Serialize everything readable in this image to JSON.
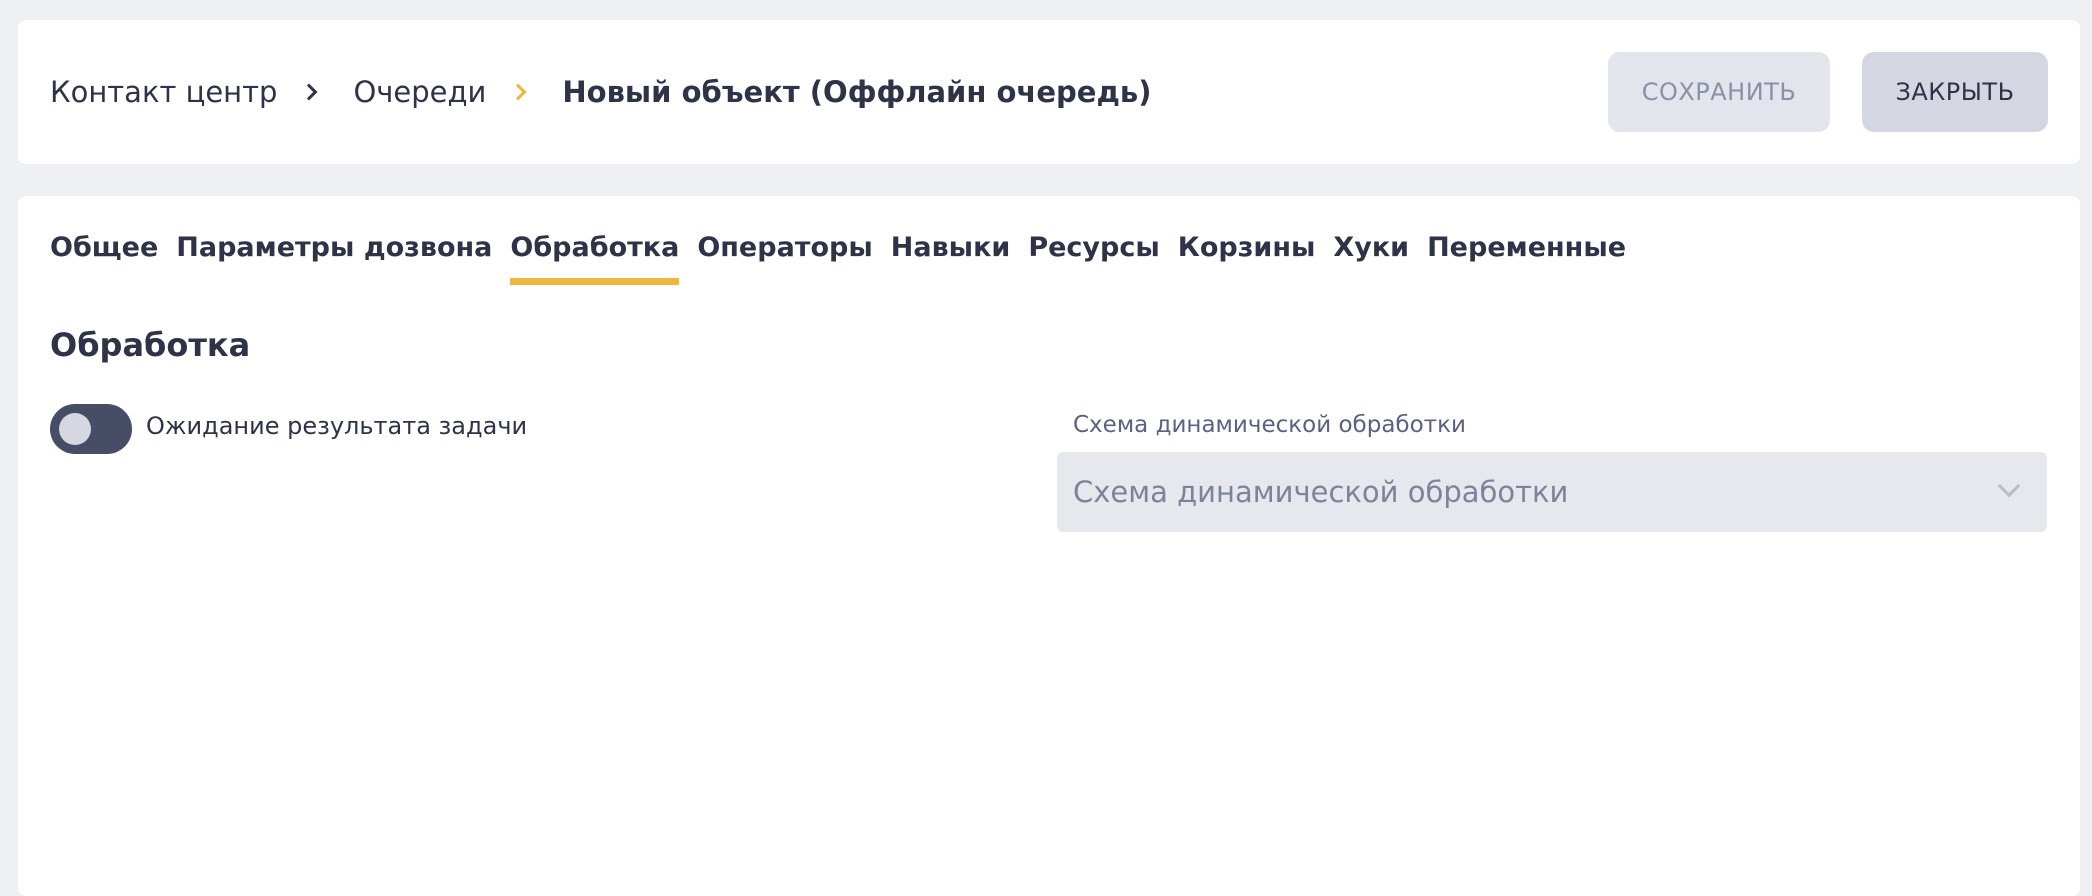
{
  "breadcrumb": {
    "items": [
      "Контакт центр",
      "Очереди"
    ],
    "current": "Новый объект (Оффлайн очередь)"
  },
  "actions": {
    "save_label": "СОХРАНИТЬ",
    "close_label": "ЗАКРЫТЬ"
  },
  "tabs": [
    {
      "label": "Общее"
    },
    {
      "label": "Параметры дозвона"
    },
    {
      "label": "Обработка",
      "active": true
    },
    {
      "label": "Операторы"
    },
    {
      "label": "Навыки"
    },
    {
      "label": "Ресурсы"
    },
    {
      "label": "Корзины"
    },
    {
      "label": "Хуки"
    },
    {
      "label": "Переменные"
    }
  ],
  "section": {
    "title": "Обработка",
    "toggle_label": "Ожидание результата задачи",
    "toggle_on": false,
    "select_label": "Схема динамической обработки",
    "select_placeholder": "Схема динамической обработки"
  },
  "colors": {
    "accent": "#f0b53c",
    "text": "#2e3347",
    "toggle_track": "#474d66"
  }
}
